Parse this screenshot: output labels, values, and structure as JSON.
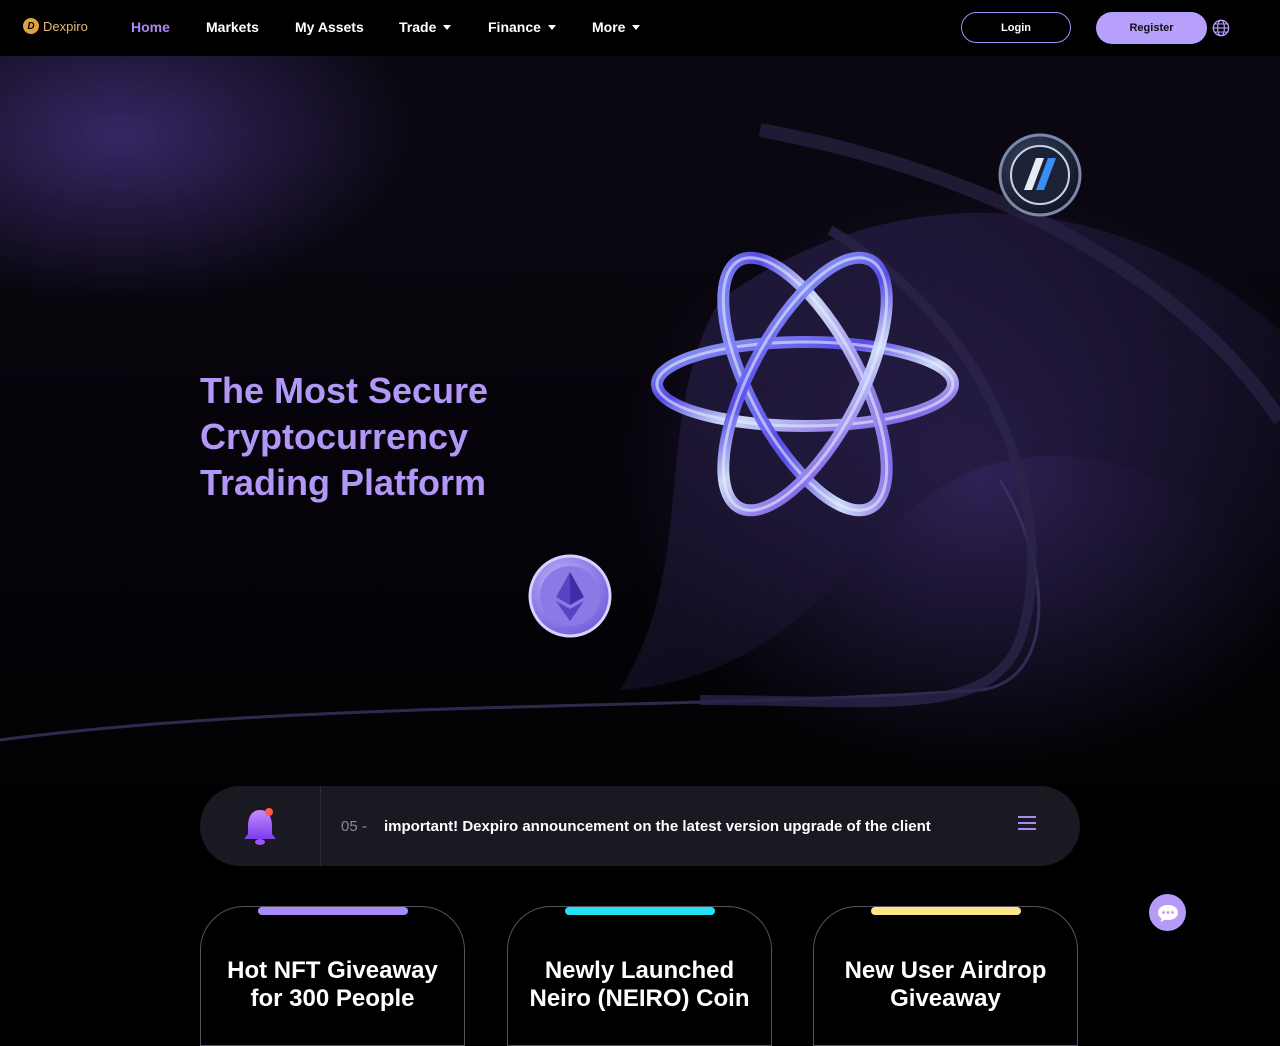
{
  "brand": {
    "name": "Dexpiro",
    "logo_mark": "D",
    "color": "#e0a23c"
  },
  "nav": {
    "items": [
      {
        "label": "Home",
        "active": true,
        "dropdown": false
      },
      {
        "label": "Markets",
        "active": false,
        "dropdown": false
      },
      {
        "label": "My Assets",
        "active": false,
        "dropdown": false
      },
      {
        "label": "Trade",
        "active": false,
        "dropdown": true
      },
      {
        "label": "Finance",
        "active": false,
        "dropdown": true
      },
      {
        "label": "More",
        "active": false,
        "dropdown": true
      }
    ],
    "login_label": "Login",
    "register_label": "Register",
    "language_icon": "globe-icon",
    "active_color": "#a989f6"
  },
  "hero": {
    "headline_lines": [
      "The Most Secure",
      "Cryptocurrency",
      "Trading Platform"
    ],
    "headline_color": "#b297f7",
    "icons": [
      "arbitrum-coin-icon",
      "ethereum-coin-icon",
      "atom-rings-graphic"
    ]
  },
  "announcement": {
    "icon": "bell-icon",
    "index": "05 -",
    "text": "important! Dexpiro announcement on the latest version upgrade of the client",
    "menu_icon": "list-icon"
  },
  "cards": [
    {
      "title_lines": [
        "Hot NFT Giveaway",
        "for 300 People"
      ],
      "accent": "#a78bfa"
    },
    {
      "title_lines": [
        "Newly Launched",
        "Neiro (NEIRO) Coin"
      ],
      "accent": "#22e1f0"
    },
    {
      "title_lines": [
        "New User Airdrop",
        "Giveaway"
      ],
      "accent": "#fde68a"
    }
  ],
  "chat": {
    "icon": "chat-bubble-icon",
    "color": "#b39bf7"
  }
}
